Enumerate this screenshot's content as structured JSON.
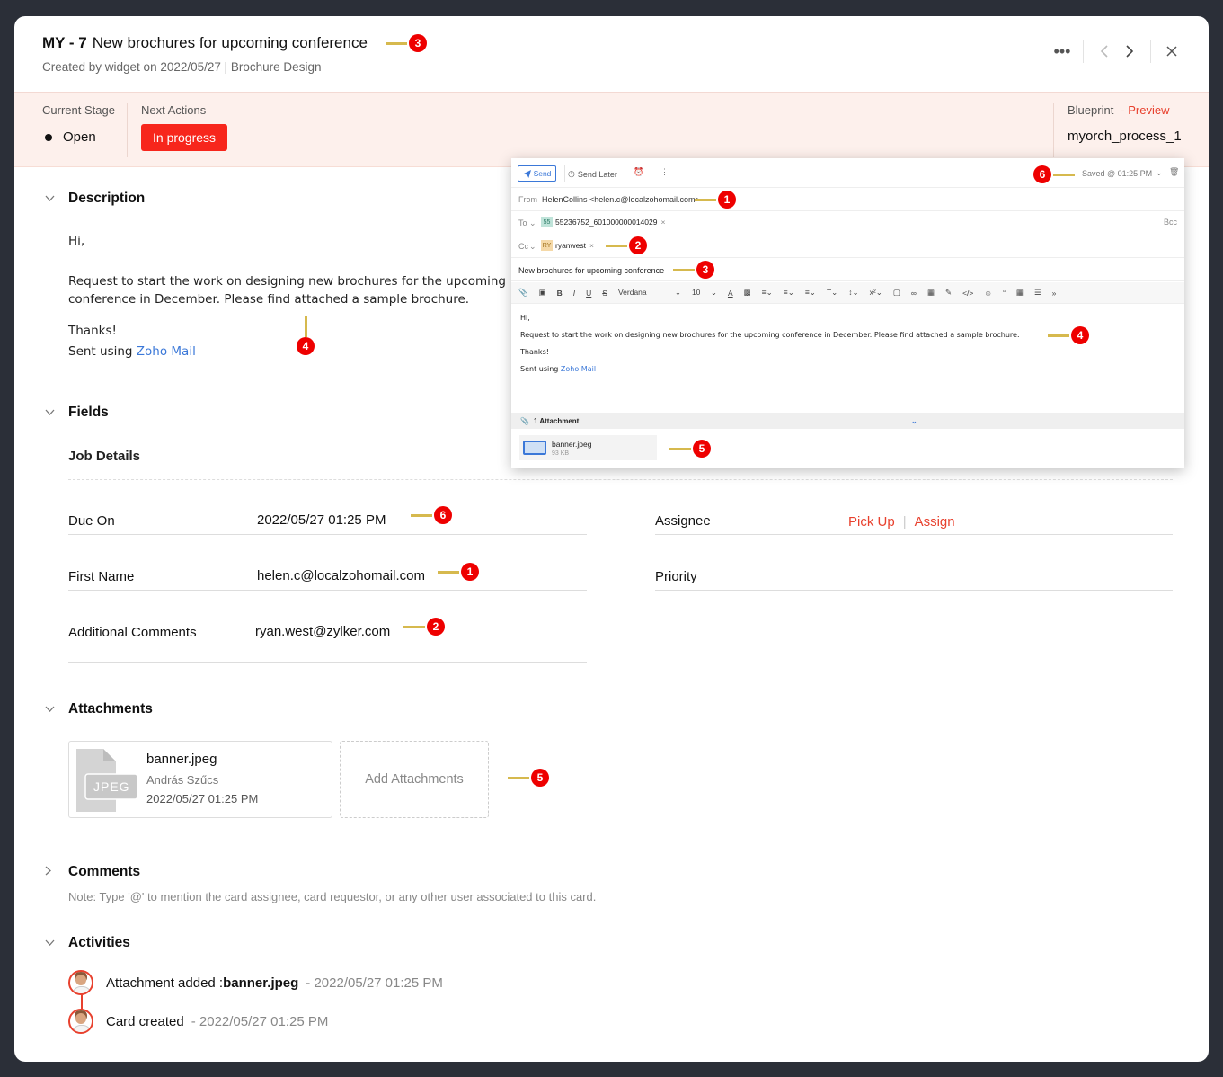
{
  "header": {
    "card_id": "MY - 7",
    "title": "New brochures for upcoming conference",
    "subtitle": "Created by  widget  on 2022/05/27  | Brochure Design"
  },
  "stage": {
    "current_stage_label": "Current Stage",
    "current_stage_value": "Open",
    "next_actions_label": "Next Actions",
    "next_action_button": "In progress",
    "blueprint_label": "Blueprint",
    "preview_link": "- Preview",
    "blueprint_value": "myorch_process_1"
  },
  "description": {
    "heading": "Description",
    "greeting": "Hi,",
    "line1": "Request to start the work on designing new brochures for the upcoming",
    "line2": "conference in December. Please find attached a sample brochure.",
    "thanks": "Thanks!",
    "sent_prefix": "Sent using ",
    "sent_link": "Zoho Mail"
  },
  "fields": {
    "heading": "Fields",
    "job_details": "Job Details",
    "due_on_label": "Due On",
    "due_on_value": "2022/05/27 01:25 PM",
    "first_name_label": "First Name",
    "first_name_value": "helen.c@localzohomail.com",
    "comments_label": "Additional Comments",
    "comments_value": "ryan.west@zylker.com",
    "assignee_label": "Assignee",
    "pick_up": "Pick Up",
    "assign": "Assign",
    "priority_label": "Priority"
  },
  "attachments": {
    "heading": "Attachments",
    "file_name": "banner.jpeg",
    "file_type": "JPEG",
    "uploader": "András Szűcs",
    "date": "2022/05/27  01:25 PM",
    "add_label": "Add Attachments"
  },
  "comments": {
    "heading": "Comments",
    "note": "Note: Type '@' to mention the card assignee, card requestor, or any other user associated to this card."
  },
  "activities": {
    "heading": "Activities",
    "items": [
      {
        "text": "Attachment added : ",
        "bold": "banner.jpeg",
        "time": "- 2022/05/27 01:25 PM"
      },
      {
        "text": "Card created",
        "bold": "",
        "time": "- 2022/05/27 01:25 PM"
      }
    ]
  },
  "email": {
    "send": "Send",
    "send_later": "Send Later",
    "saved": "Saved @ 01:25 PM",
    "from_label": "From",
    "from_value": "HelenCollins <helen.c@localzohomail.com>",
    "to_label": "To",
    "to_avatar": "55",
    "to_value": "55236752_601000000014029",
    "bcc": "Bcc",
    "cc_label": "Cc",
    "cc_avatar": "RY",
    "cc_value": "ryanwest",
    "subject": "New brochures for upcoming conference",
    "font": "Verdana",
    "size": "10",
    "body_hi": "Hi,",
    "body_line": "Request to start the work on designing new brochures for the upcoming conference in December. Please find attached a sample brochure.",
    "body_thanks": "Thanks!",
    "body_sent": "Sent using ",
    "body_link": "Zoho Mail",
    "attach_count": "1 Attachment",
    "file_name": "banner.jpeg",
    "file_size": "93 KB"
  },
  "markers": [
    "1",
    "2",
    "3",
    "4",
    "5",
    "6"
  ],
  "colors": {
    "accent": "#e8412e",
    "button": "#f7261c",
    "marker": "#e00000",
    "marker_bar": "#d6b94e",
    "stage_bg": "#fdf0ec"
  }
}
